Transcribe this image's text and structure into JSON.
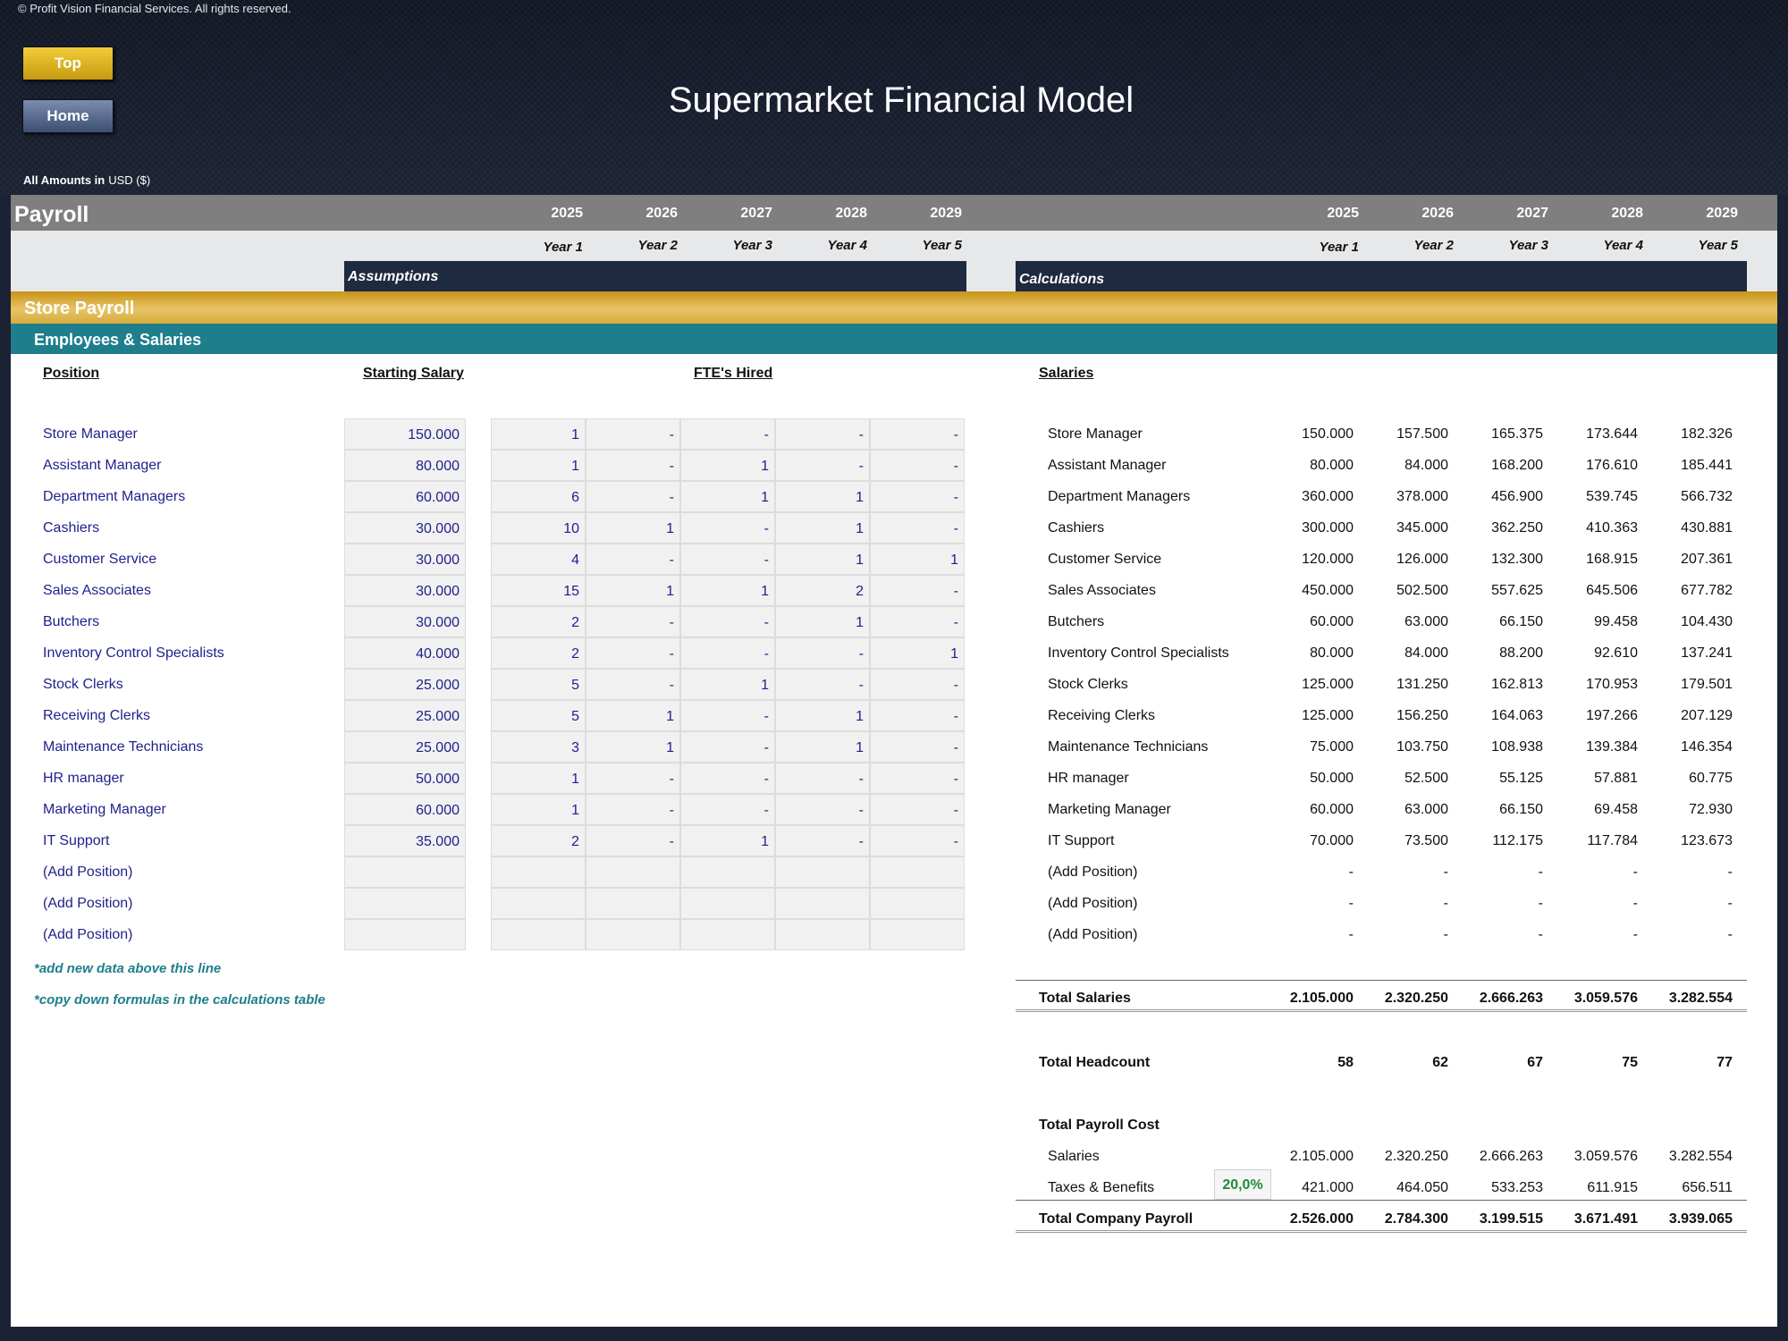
{
  "copyright": "© Profit Vision Financial Services. All rights reserved.",
  "buttons": {
    "top": "Top",
    "home": "Home"
  },
  "title": "Supermarket Financial Model",
  "amounts": {
    "label": "All Amounts in",
    "currency": "USD ($)"
  },
  "sheet": {
    "name": "Payroll",
    "years": [
      "2025",
      "2026",
      "2027",
      "2028",
      "2029"
    ],
    "year_labels": [
      "Year 1",
      "Year 2",
      "Year 3",
      "Year 4",
      "Year 5"
    ],
    "assumptions_label": "Assumptions",
    "calculations_label": "Calculations",
    "section": "Store Payroll",
    "subsection": "Employees & Salaries"
  },
  "headers": {
    "position": "Position",
    "starting_salary": "Starting Salary",
    "ftes_hired": "FTE's Hired",
    "salaries": "Salaries"
  },
  "positions": [
    {
      "name": "Store Manager",
      "salary": "150.000",
      "ftes": [
        "1",
        "-",
        "-",
        "-",
        "-"
      ],
      "salaries": [
        "150.000",
        "157.500",
        "165.375",
        "173.644",
        "182.326"
      ]
    },
    {
      "name": "Assistant Manager",
      "salary": "80.000",
      "ftes": [
        "1",
        "-",
        "1",
        "-",
        "-"
      ],
      "salaries": [
        "80.000",
        "84.000",
        "168.200",
        "176.610",
        "185.441"
      ]
    },
    {
      "name": "Department Managers",
      "salary": "60.000",
      "ftes": [
        "6",
        "-",
        "1",
        "1",
        "-"
      ],
      "salaries": [
        "360.000",
        "378.000",
        "456.900",
        "539.745",
        "566.732"
      ]
    },
    {
      "name": "Cashiers",
      "salary": "30.000",
      "ftes": [
        "10",
        "1",
        "-",
        "1",
        "-"
      ],
      "salaries": [
        "300.000",
        "345.000",
        "362.250",
        "410.363",
        "430.881"
      ]
    },
    {
      "name": "Customer Service",
      "salary": "30.000",
      "ftes": [
        "4",
        "-",
        "-",
        "1",
        "1"
      ],
      "salaries": [
        "120.000",
        "126.000",
        "132.300",
        "168.915",
        "207.361"
      ]
    },
    {
      "name": "Sales Associates",
      "salary": "30.000",
      "ftes": [
        "15",
        "1",
        "1",
        "2",
        "-"
      ],
      "salaries": [
        "450.000",
        "502.500",
        "557.625",
        "645.506",
        "677.782"
      ]
    },
    {
      "name": "Butchers",
      "salary": "30.000",
      "ftes": [
        "2",
        "-",
        "-",
        "1",
        "-"
      ],
      "salaries": [
        "60.000",
        "63.000",
        "66.150",
        "99.458",
        "104.430"
      ]
    },
    {
      "name": "Inventory Control Specialists",
      "salary": "40.000",
      "ftes": [
        "2",
        "-",
        "-",
        "-",
        "1"
      ],
      "salaries": [
        "80.000",
        "84.000",
        "88.200",
        "92.610",
        "137.241"
      ]
    },
    {
      "name": "Stock Clerks",
      "salary": "25.000",
      "ftes": [
        "5",
        "-",
        "1",
        "-",
        "-"
      ],
      "salaries": [
        "125.000",
        "131.250",
        "162.813",
        "170.953",
        "179.501"
      ]
    },
    {
      "name": "Receiving Clerks",
      "salary": "25.000",
      "ftes": [
        "5",
        "1",
        "-",
        "1",
        "-"
      ],
      "salaries": [
        "125.000",
        "156.250",
        "164.063",
        "197.266",
        "207.129"
      ]
    },
    {
      "name": "Maintenance Technicians",
      "salary": "25.000",
      "ftes": [
        "3",
        "1",
        "-",
        "1",
        "-"
      ],
      "salaries": [
        "75.000",
        "103.750",
        "108.938",
        "139.384",
        "146.354"
      ]
    },
    {
      "name": "HR manager",
      "salary": "50.000",
      "ftes": [
        "1",
        "-",
        "-",
        "-",
        "-"
      ],
      "salaries": [
        "50.000",
        "52.500",
        "55.125",
        "57.881",
        "60.775"
      ]
    },
    {
      "name": "Marketing Manager",
      "salary": "60.000",
      "ftes": [
        "1",
        "-",
        "-",
        "-",
        "-"
      ],
      "salaries": [
        "60.000",
        "63.000",
        "66.150",
        "69.458",
        "72.930"
      ]
    },
    {
      "name": "IT Support",
      "salary": "35.000",
      "ftes": [
        "2",
        "-",
        "1",
        "-",
        "-"
      ],
      "salaries": [
        "70.000",
        "73.500",
        "112.175",
        "117.784",
        "123.673"
      ]
    },
    {
      "name": "(Add Position)",
      "salary": "",
      "ftes": [
        "",
        "",
        "",
        "",
        ""
      ],
      "salaries": [
        "-",
        "-",
        "-",
        "-",
        "-"
      ]
    },
    {
      "name": "(Add Position)",
      "salary": "",
      "ftes": [
        "",
        "",
        "",
        "",
        ""
      ],
      "salaries": [
        "-",
        "-",
        "-",
        "-",
        "-"
      ]
    },
    {
      "name": "(Add Position)",
      "salary": "",
      "ftes": [
        "",
        "",
        "",
        "",
        ""
      ],
      "salaries": [
        "-",
        "-",
        "-",
        "-",
        "-"
      ]
    }
  ],
  "notes": [
    "*add new data above this line",
    "*copy down formulas in the calculations table"
  ],
  "totals": {
    "total_salaries": {
      "label": "Total Salaries",
      "values": [
        "2.105.000",
        "2.320.250",
        "2.666.263",
        "3.059.576",
        "3.282.554"
      ]
    },
    "total_headcount": {
      "label": "Total Headcount",
      "values": [
        "58",
        "62",
        "67",
        "75",
        "77"
      ]
    },
    "total_payroll_cost_label": "Total Payroll Cost",
    "salaries": {
      "label": "Salaries",
      "values": [
        "2.105.000",
        "2.320.250",
        "2.666.263",
        "3.059.576",
        "3.282.554"
      ]
    },
    "taxes": {
      "label": "Taxes & Benefits",
      "rate": "20,0%",
      "values": [
        "421.000",
        "464.050",
        "533.253",
        "611.915",
        "656.511"
      ]
    },
    "total_company_payroll": {
      "label": "Total Company Payroll",
      "values": [
        "2.526.000",
        "2.784.300",
        "3.199.515",
        "3.671.491",
        "3.939.065"
      ]
    }
  },
  "colors": {
    "gold": "#d8ac3a",
    "teal": "#1e7e8c",
    "navy": "#1e2a40",
    "input_blue": "#1f1f8c",
    "rate_green": "#1e8a3a"
  }
}
